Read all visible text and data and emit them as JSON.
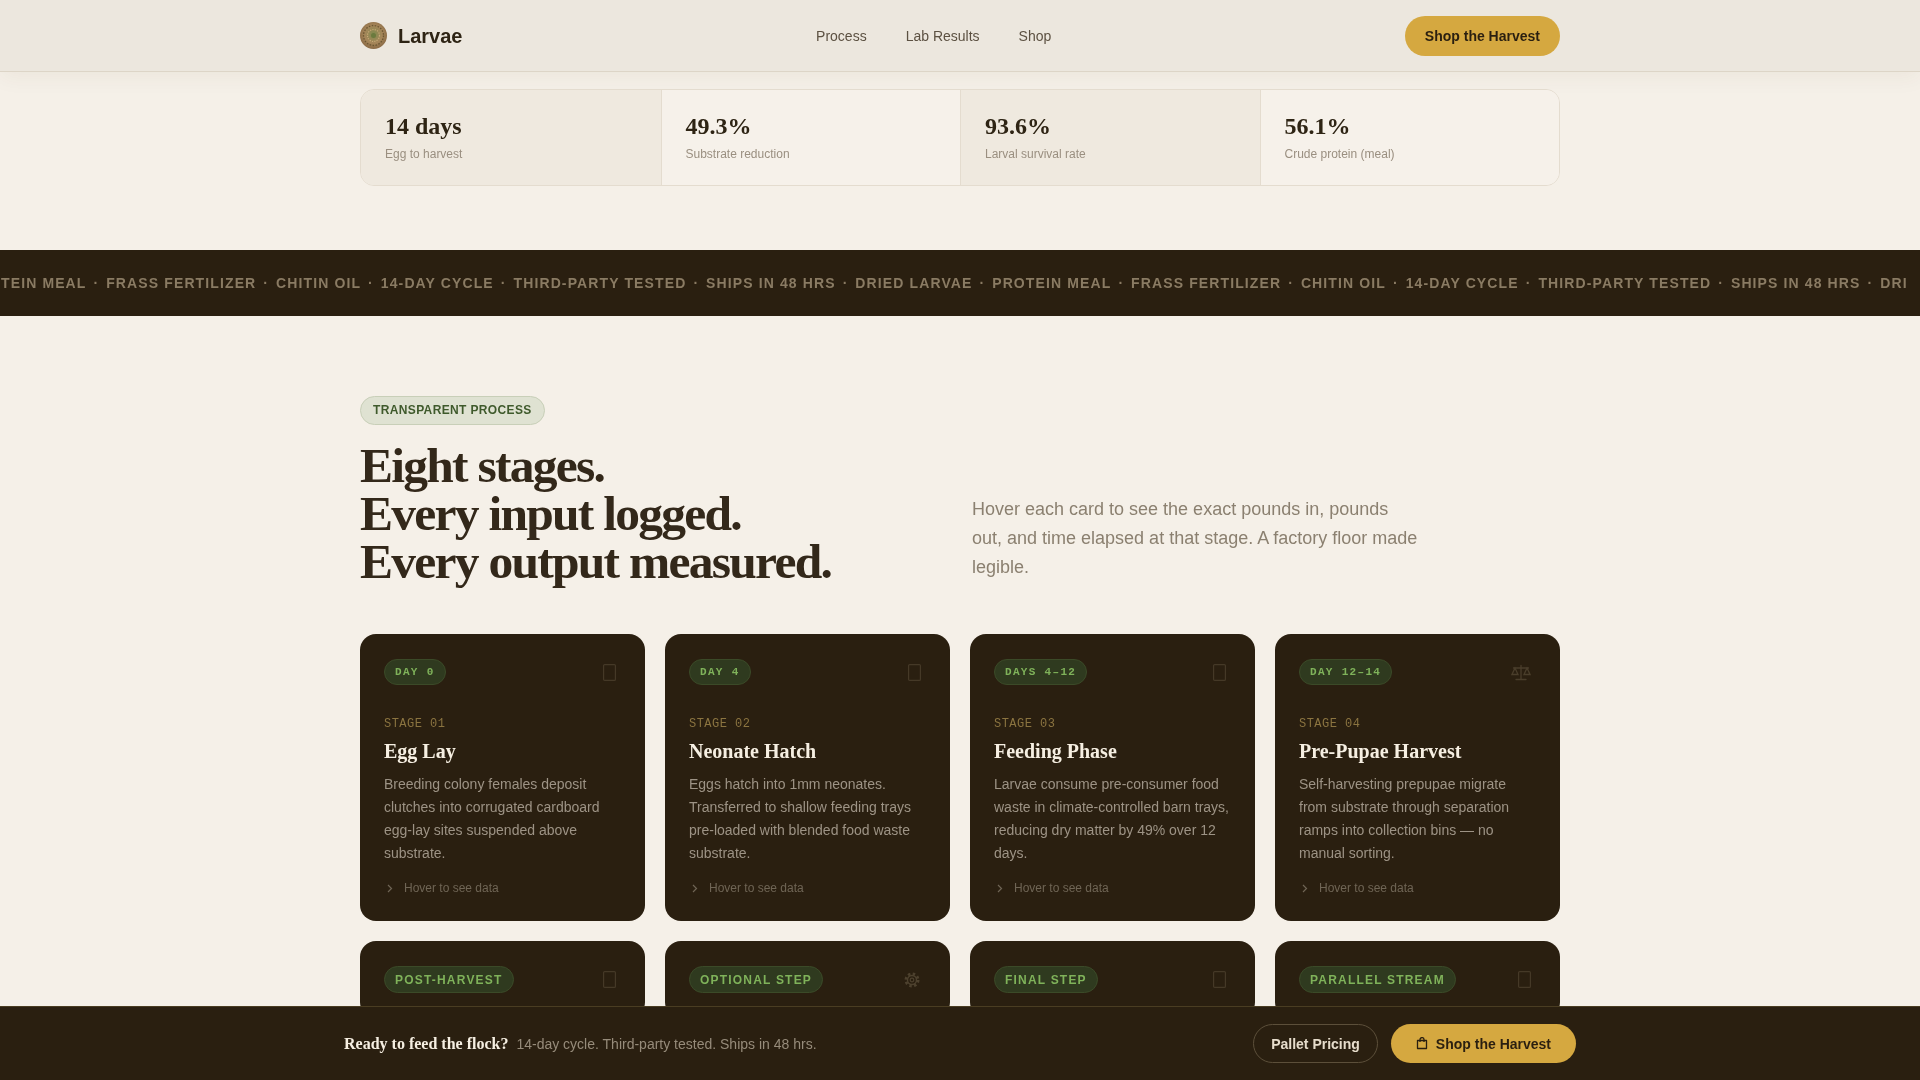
{
  "header": {
    "brand": "Larvae",
    "nav": [
      {
        "label": "Process"
      },
      {
        "label": "Lab Results"
      },
      {
        "label": "Shop"
      }
    ],
    "cta": "Shop the Harvest"
  },
  "stats": [
    {
      "value": "14 days",
      "label": "Egg to harvest"
    },
    {
      "value": "49.3%",
      "label": "Substrate reduction"
    },
    {
      "value": "93.6%",
      "label": "Larval survival rate"
    },
    {
      "value": "56.1%",
      "label": "Crude protein (meal)"
    }
  ],
  "ticker": {
    "separator": "·",
    "items": [
      "TEIN MEAL",
      "FRASS FERTILIZER",
      "CHITIN OIL",
      "14-DAY CYCLE",
      "THIRD-PARTY TESTED",
      "SHIPS IN 48 HRS",
      "DRIED LARVAE",
      "PROTEIN MEAL",
      "FRASS FERTILIZER",
      "CHITIN OIL",
      "14-DAY CYCLE",
      "THIRD-PARTY TESTED",
      "SHIPS IN 48 HRS",
      "DRI"
    ]
  },
  "process": {
    "eyebrow": "TRANSPARENT PROCESS",
    "heading_lines": [
      "Eight stages.",
      "Every input logged.",
      "Every output measured."
    ],
    "intro": "Hover each card to see the exact pounds in, pounds out, and time elapsed at that stage. A factory floor made legible.",
    "stages": [
      {
        "kind": "day",
        "badge": "DAY 0",
        "stage": "STAGE 01",
        "title": "Egg Lay",
        "description": "Breeding colony females deposit clutches into corrugated cardboard egg-lay sites suspended above substrate.",
        "hint": "Hover to see data"
      },
      {
        "kind": "day",
        "badge": "DAY 4",
        "stage": "STAGE 02",
        "title": "Neonate Hatch",
        "description": "Eggs hatch into 1mm neonates. Transferred to shallow feeding trays pre-loaded with blended food waste substrate.",
        "hint": "Hover to see data"
      },
      {
        "kind": "day",
        "badge": "DAYS 4–12",
        "stage": "STAGE 03",
        "title": "Feeding Phase",
        "description": "Larvae consume pre-consumer food waste in climate-controlled barn trays, reducing dry matter by 49% over 12 days.",
        "hint": "Hover to see data"
      },
      {
        "kind": "day",
        "badge": "DAY 12–14",
        "stage": "STAGE 04",
        "title": "Pre-Pupae Harvest",
        "description": "Self-harvesting prepupae migrate from substrate through separation ramps into collection bins — no manual sorting.",
        "hint": "Hover to see data"
      },
      {
        "kind": "step",
        "badge": "POST-HARVEST"
      },
      {
        "kind": "step",
        "badge": "OPTIONAL STEP"
      },
      {
        "kind": "step",
        "badge": "FINAL STEP"
      },
      {
        "kind": "step",
        "badge": "PARALLEL STREAM"
      }
    ]
  },
  "cta_bar": {
    "title": "Ready to feed the flock?",
    "text": "14-day cycle. Third-party tested. Ships in 48 hrs.",
    "buttons": [
      {
        "kind": "outline",
        "label": "Pallet Pricing"
      },
      {
        "kind": "primary",
        "label": "Shop the Harvest"
      }
    ]
  }
}
